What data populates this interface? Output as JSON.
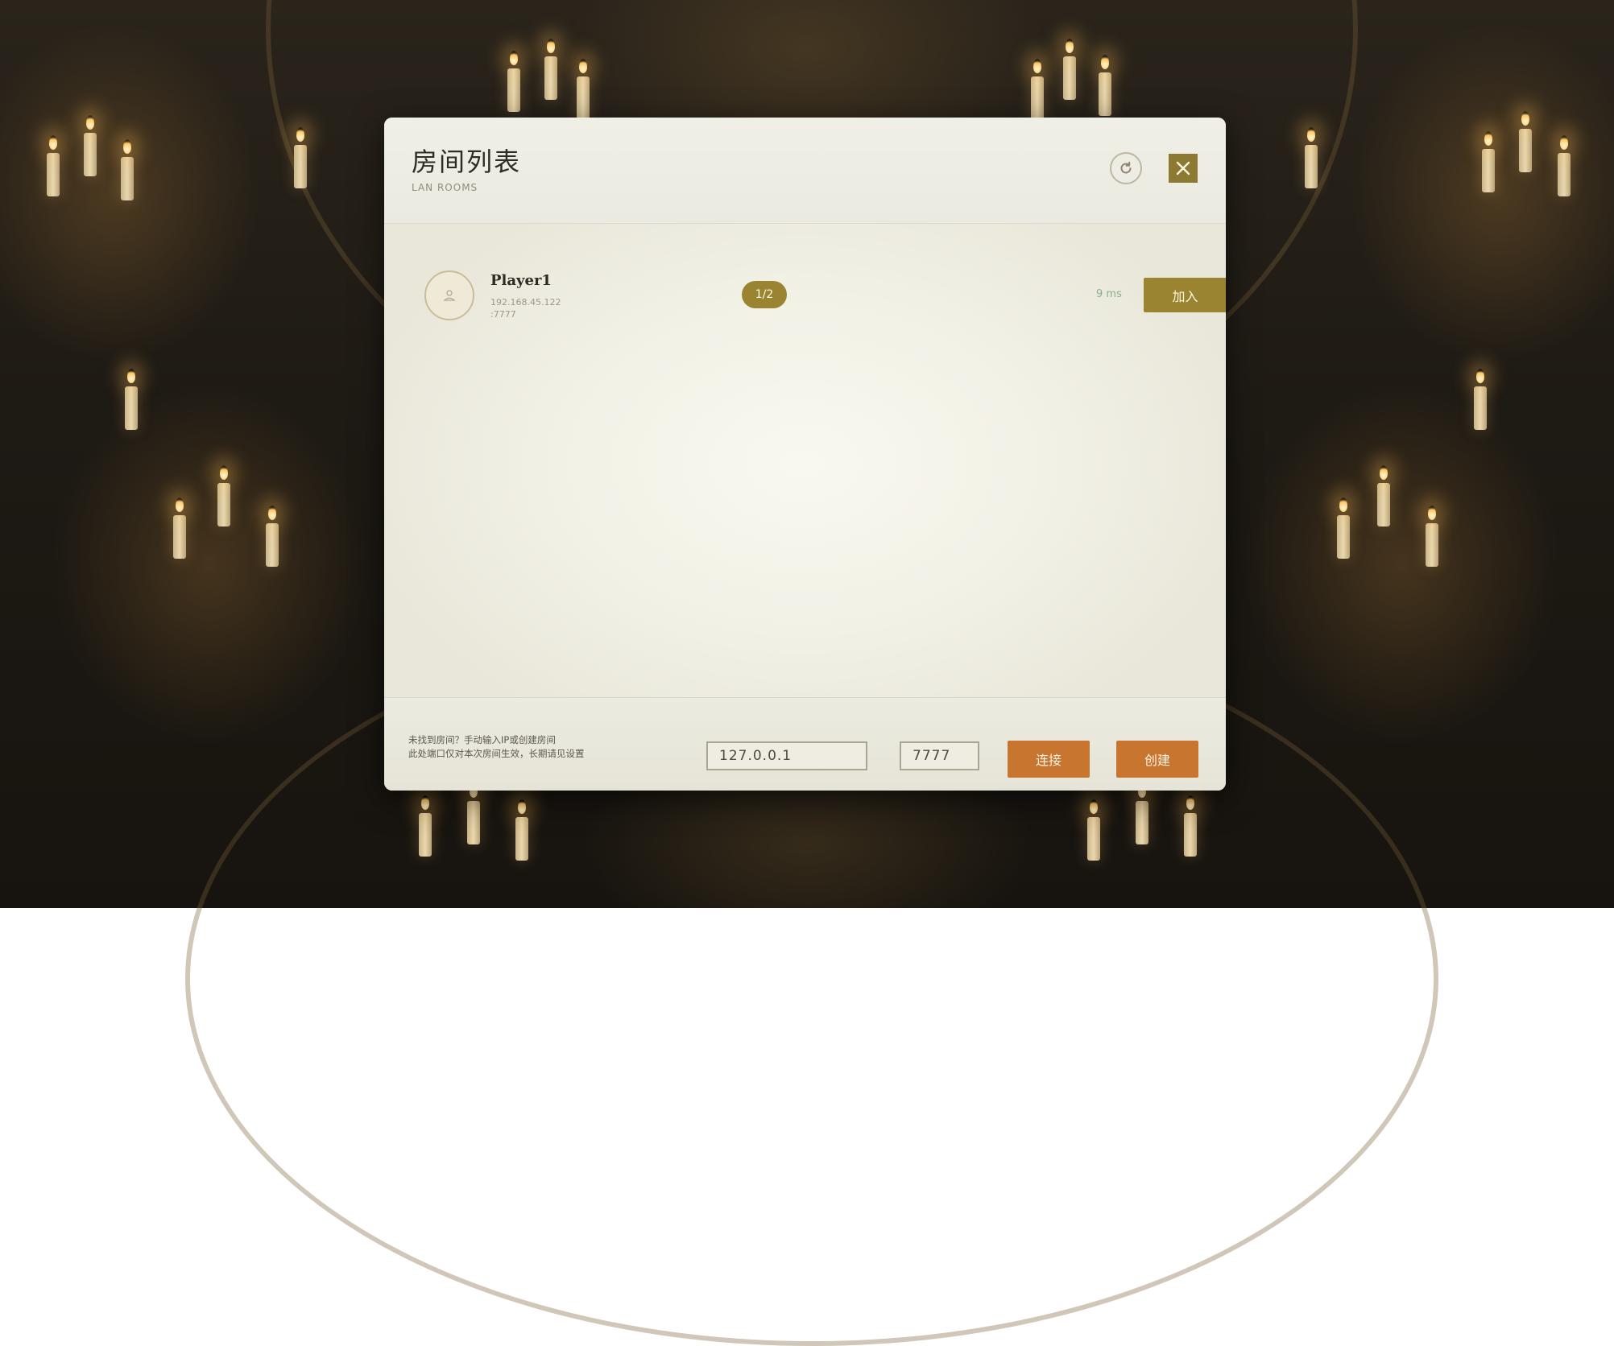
{
  "dialog": {
    "title": "房间列表",
    "subtitle": "LAN ROOMS",
    "icons": {
      "refresh": "refresh-icon",
      "close": "close-icon"
    }
  },
  "rooms": [
    {
      "name": "Player1",
      "address": "192.168.45.122\n:7777",
      "players": "1/2",
      "ping": "9 ms",
      "join_label": "加入",
      "avatar_icon": "user-icon"
    }
  ],
  "footer": {
    "hint_line1": "未找到房间？手动输入IP或创建房间",
    "hint_line2": "此处端口仅对本次房间生效，长期请见设置",
    "ip_value": "127.0.0.1",
    "port_value": "7777",
    "connect_label": "连接",
    "create_label": "创建"
  },
  "colors": {
    "accent_gold": "#9a8431",
    "accent_orange": "#c8752f",
    "ping_green": "#88b08a"
  }
}
